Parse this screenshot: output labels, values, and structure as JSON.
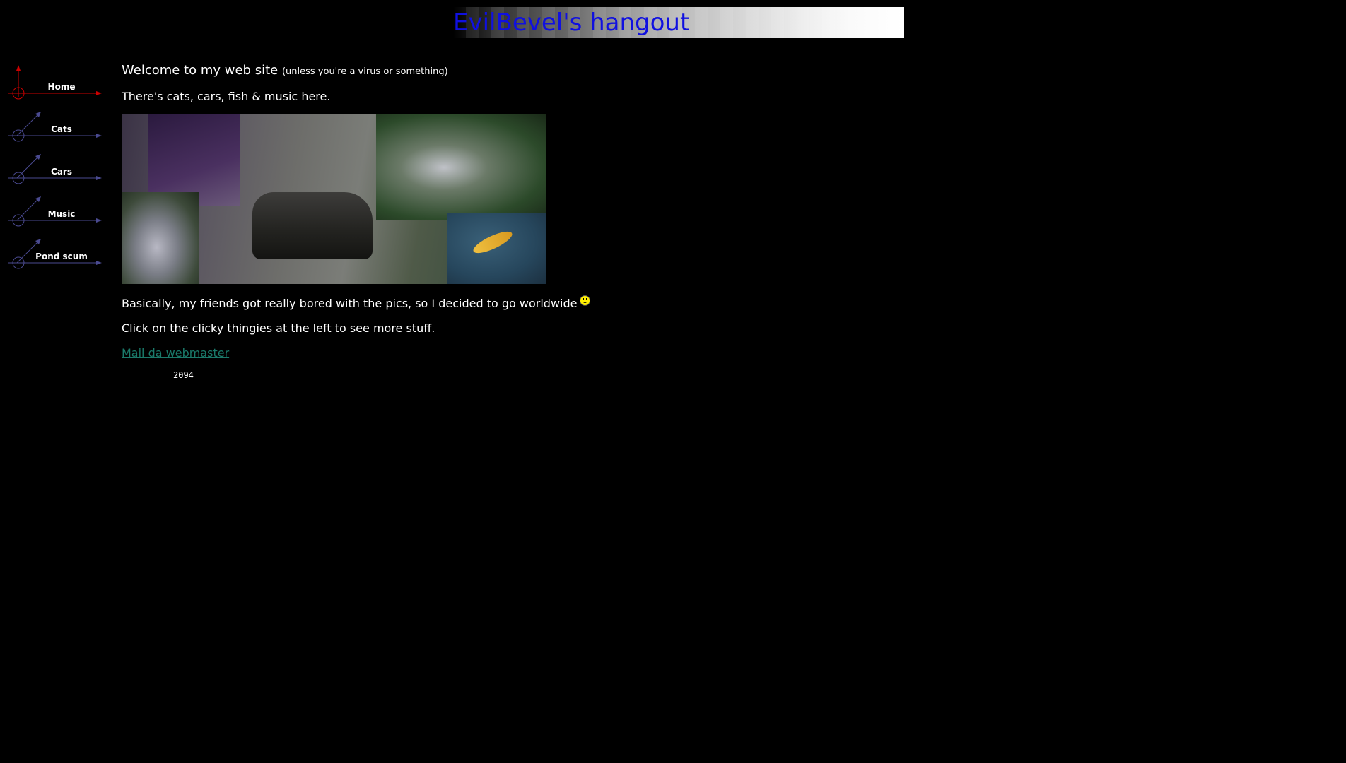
{
  "banner": {
    "title": "EvilBevel's hangout"
  },
  "nav": {
    "items": [
      {
        "label": "Home",
        "active": true
      },
      {
        "label": "Cats",
        "active": false
      },
      {
        "label": "Cars",
        "active": false
      },
      {
        "label": "Music",
        "active": false
      },
      {
        "label": "Pond scum",
        "active": false
      }
    ],
    "active_color": "#cc0000",
    "inactive_color": "#4a4a90"
  },
  "main": {
    "welcome": "Welcome to my web site",
    "welcome_small": "(unless you're a virus or something)",
    "intro": "There's cats, cars, fish & music here.",
    "worldwide": "Basically, my friends got really bored with the pics, so I decided to go worldwide",
    "click_hint": "Click on the clicky thingies at the left to see more stuff.",
    "mail_link": "Mail da webmaster",
    "hit_counter": "2094"
  },
  "colors": {
    "background": "#000000",
    "text": "#ffffff",
    "title": "#1010e0",
    "link": "#1a7a6a"
  }
}
